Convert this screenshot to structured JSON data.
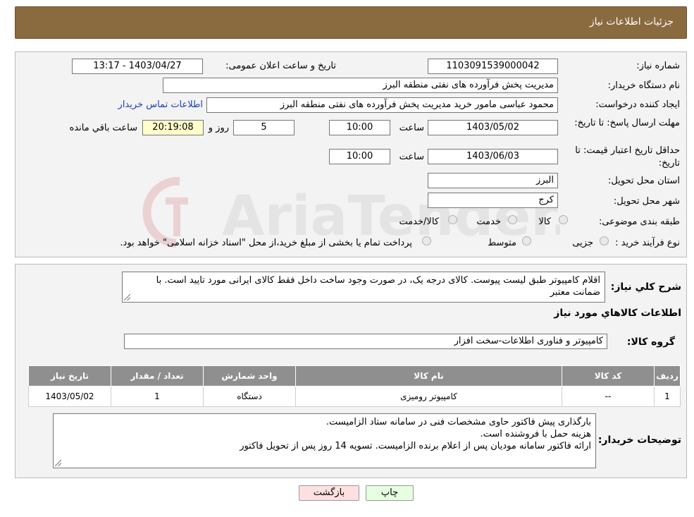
{
  "header": {
    "title": "جزئیات اطلاعات نیاز"
  },
  "form": {
    "need_number_label": "شماره نیاز:",
    "need_number": "1103091539000042",
    "announce_label": "تاریخ و ساعت اعلان عمومی:",
    "announce_value": "1403/04/27 - 13:17",
    "buyer_label": "نام دستگاه خریدار:",
    "buyer_value": "مدیریت پخش فرآورده های نفتی منطقه البرز",
    "creator_label": "ایجاد کننده درخواست:",
    "creator_value": "محمود عباسی مامور خرید  مدیریت پخش فرآورده های نفتی منطقه البرز",
    "contact_link": "اطلاعات تماس خریدار",
    "deadline_label": "مهلت ارسال پاسخ: تا تاریخ:",
    "deadline_date": "1403/05/02",
    "time_label": "ساعت",
    "deadline_time": "10:00",
    "days_value": "5",
    "days_label": "روز و",
    "remaining_value": "20:19:08",
    "remaining_label": "ساعت باقي مانده",
    "validity_label": "حداقل تاریخ اعتبار قیمت: تا تاریخ:",
    "validity_date": "1403/06/03",
    "validity_time": "10:00",
    "province_label": "استان محل تحویل:",
    "province_value": "البرز",
    "city_label": "شهر محل تحویل:",
    "city_value": "کرج",
    "category_label": "طبقه بندی موضوعی:",
    "category_options": [
      "کالا",
      "خدمت",
      "کالا/خدمت"
    ],
    "process_label": "نوع فرآیند خرید :",
    "process_options": [
      "جزیی",
      "متوسط"
    ],
    "process_note": "پرداخت تمام یا بخشی از مبلغ خرید،از محل \"اسناد خزانه اسلامی\" خواهد بود."
  },
  "details": {
    "summary_label": "شرح کلي نياز:",
    "summary_text": "اقلام کامپیوتر طبق لیست پیوست. کالای درجه یک، در صورت وجود ساخت داخل فقط کالای ایرانی مورد تایید است. با ضمانت معتبر",
    "goods_heading": "اطلاعات کالاهاي مورد نياز",
    "group_label": "گروه کالا:",
    "group_value": "کامپیوتر و فناوری اطلاعات-سخت افزار",
    "table_headers": [
      "رديف",
      "کد کالا",
      "نام کالا",
      "واحد شمارش",
      "تعداد / مقدار",
      "تاريخ نياز"
    ],
    "table_rows": [
      [
        "1",
        "--",
        "کامپیوتر رومیزی",
        "دستگاه",
        "1",
        "1403/05/02"
      ]
    ],
    "buyer_notes_label": "توضيحات خريدار:",
    "buyer_notes": [
      "بارگذاری پیش فاکتور حاوی مشخصات فنی در سامانه ستاد الزامیست.",
      "هزینه حمل با فروشنده است.",
      "ارائه فاکتور سامانه مودیان پس از اعلام برنده الزامیست. تسویه 14 روز پس از تحویل فاکتور"
    ]
  },
  "buttons": {
    "back": "بازگشت",
    "print": "چاپ"
  },
  "colors": {
    "header_bg": "#8a6a3f",
    "table_header_bg": "#8f8f8f",
    "back_bg": "#ffe0e0",
    "print_bg": "#e6ffe0"
  },
  "watermark_text": "AriaTender.neT"
}
